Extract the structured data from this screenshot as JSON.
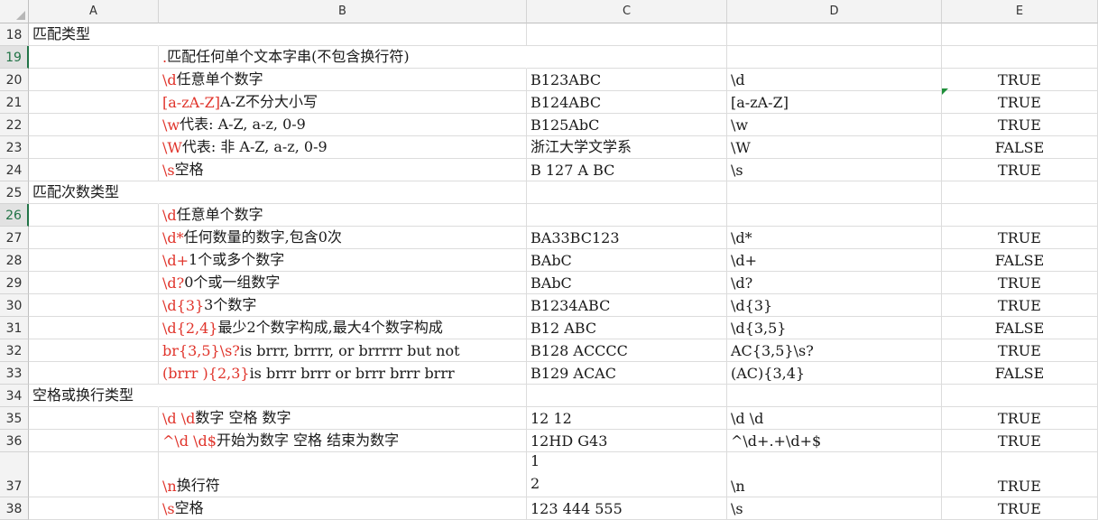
{
  "columns": [
    "A",
    "B",
    "C",
    "D",
    "E"
  ],
  "rows": [
    {
      "n": "18",
      "a": "匹配类型",
      "b_pattern": "",
      "b_desc": "",
      "c": "",
      "d": "",
      "e": ""
    },
    {
      "n": "19",
      "a": "",
      "b_pattern": ".",
      "b_desc": " 匹配任何单个文本字串(不包含换行符)",
      "c": "",
      "d": "",
      "e": "",
      "active": true
    },
    {
      "n": "20",
      "a": "",
      "b_pattern": "\\d",
      "b_desc": " 任意单个数字",
      "c": "B123ABC",
      "d": "\\d",
      "e": "TRUE"
    },
    {
      "n": "21",
      "a": "",
      "b_pattern": "[a-zA-Z]",
      "b_desc": " A-Z不分大小写",
      "c": "B124ABC",
      "d": "[a-zA-Z]",
      "e": "TRUE"
    },
    {
      "n": "22",
      "a": "",
      "b_pattern": "\\w",
      "b_desc": " 代表: A-Z, a-z, 0-9",
      "c": "B125AbC",
      "d": "\\w",
      "e": "TRUE"
    },
    {
      "n": "23",
      "a": "",
      "b_pattern": "\\W",
      "b_desc": " 代表:  非 A-Z, a-z, 0-9",
      "c": "浙江大学文学系",
      "d": "\\W",
      "e": "FALSE"
    },
    {
      "n": "24",
      "a": "",
      "b_pattern": "\\s",
      "b_desc": " 空格",
      "c": "B 127 A BC",
      "d": "\\s",
      "e": "TRUE"
    },
    {
      "n": "25",
      "a": "匹配次数类型",
      "b_pattern": "",
      "b_desc": "",
      "c": "",
      "d": "",
      "e": ""
    },
    {
      "n": "26",
      "a": "",
      "b_pattern": "\\d",
      "b_desc": " 任意单个数字",
      "c": "",
      "d": "",
      "e": "",
      "active": true
    },
    {
      "n": "27",
      "a": "",
      "b_pattern": "\\d*",
      "b_desc": " 任何数量的数字,包含0次",
      "c": "BA33BC123",
      "d": "\\d*",
      "e": "TRUE"
    },
    {
      "n": "28",
      "a": "",
      "b_pattern": "\\d+",
      "b_desc": " 1个或多个数字",
      "c": "BAbC",
      "d": "\\d+",
      "e": "FALSE"
    },
    {
      "n": "29",
      "a": "",
      "b_pattern": "\\d?",
      "b_desc": " 0个或一组数字",
      "c": "BAbC",
      "d": "\\d?",
      "e": "TRUE"
    },
    {
      "n": "30",
      "a": "",
      "b_pattern": "\\d{3}",
      "b_desc": " 3个数字",
      "c": "B1234ABC",
      "d": "\\d{3}",
      "e": "TRUE"
    },
    {
      "n": "31",
      "a": "",
      "b_pattern": "\\d{2,4}",
      "b_desc": " 最少2个数字构成,最大4个数字构成",
      "c": "B12 ABC",
      "d": "\\d{3,5}",
      "e": "FALSE"
    },
    {
      "n": "32",
      "a": "",
      "b_pattern": "br{3,5}\\s?",
      "b_desc": "  is brrr, brrrr, or brrrrr but not",
      "c": "B128 ACCCC",
      "d": "AC{3,5}\\s?",
      "e": "TRUE"
    },
    {
      "n": "33",
      "a": "",
      "b_pattern": "(brrr ){2,3}",
      "b_desc": " is brrr brrr or brrr brrr brrr",
      "c": "B129 ACAC",
      "d": "(AC){3,4}",
      "e": "FALSE"
    },
    {
      "n": "34",
      "a": "空格或换行类型",
      "b_pattern": "",
      "b_desc": "",
      "c": "",
      "d": "",
      "e": ""
    },
    {
      "n": "35",
      "a": "",
      "b_pattern": "\\d \\d",
      "b_desc": " 数字 空格 数字",
      "c": "12 12",
      "d": "\\d \\d",
      "e": "TRUE"
    },
    {
      "n": "36",
      "a": "",
      "b_pattern": "^\\d \\d$",
      "b_desc": " 开始为数字 空格 结束为数字",
      "c": "12HD G43",
      "d": "^\\d+.+\\d+$",
      "e": "TRUE"
    },
    {
      "n": "37",
      "a": "",
      "b_pattern": "\\n",
      "b_desc": " 换行符",
      "c": "1\n2",
      "d": "\\n",
      "e": "TRUE",
      "tall": true
    },
    {
      "n": "38",
      "a": "",
      "b_pattern": "\\s",
      "b_desc": " 空格",
      "c": "123 444 555",
      "d": "\\s",
      "e": "TRUE"
    }
  ]
}
